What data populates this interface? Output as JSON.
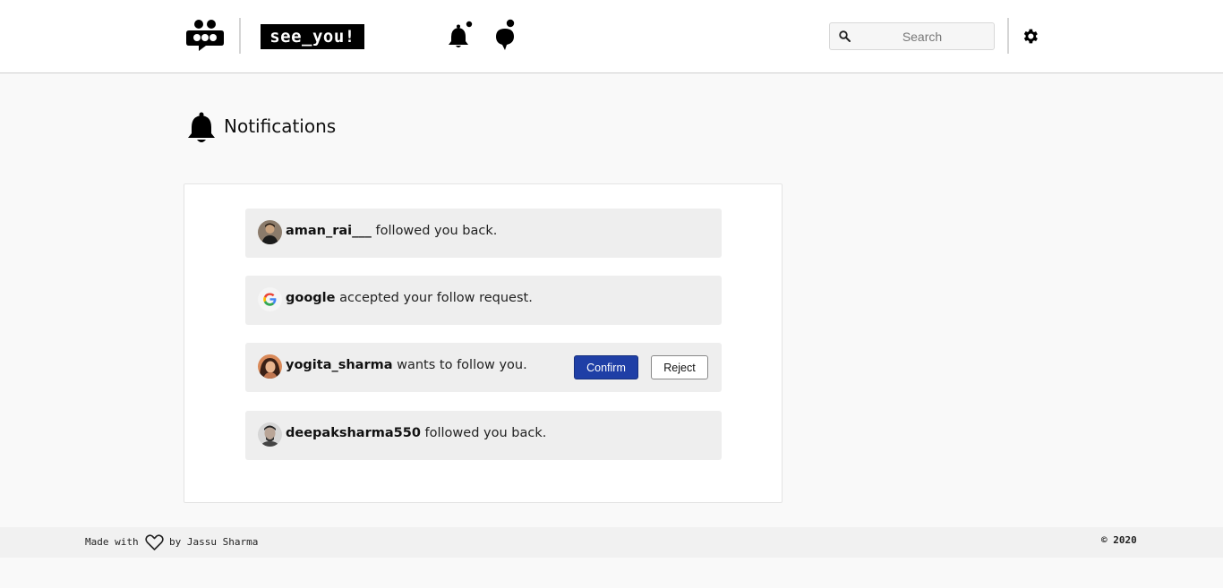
{
  "header": {
    "brand": "see_you!",
    "search_placeholder": "Search",
    "icons": [
      "logo-chat-face-icon",
      "bell-icon",
      "chat-bubble-icon",
      "search-icon",
      "gear-icon"
    ]
  },
  "page": {
    "title": "Notifications",
    "title_icon": "bell-icon"
  },
  "notifications": [
    {
      "username": "aman_rai___",
      "message": "followed you back.",
      "avatar": "user-photo"
    },
    {
      "username": "google",
      "message": "accepted your follow request.",
      "avatar": "google-logo"
    },
    {
      "username": "yogita_sharma",
      "message": "wants to follow you.",
      "avatar": "user-photo",
      "actions": {
        "confirm": "Confirm",
        "reject": "Reject"
      }
    },
    {
      "username": "deepaksharma550",
      "message": "followed you back.",
      "avatar": "user-photo"
    }
  ],
  "footer": {
    "made_with": "Made with",
    "by": "by Jassu Sharma",
    "copyright": "© 2020"
  },
  "colors": {
    "confirm_button": "#1f3fa6",
    "notification_bg": "#eeeeee",
    "page_bg": "#f9f9f9"
  }
}
